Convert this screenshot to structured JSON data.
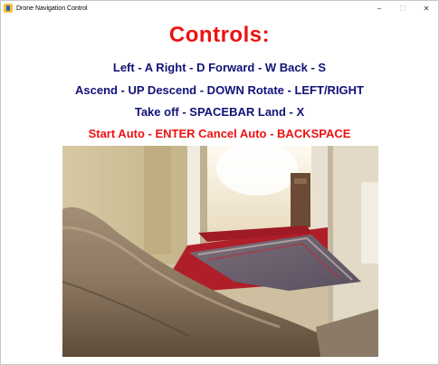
{
  "window": {
    "title": "Drone Navigation Control",
    "controls": {
      "minimize": "–",
      "maximize": "☐",
      "close": "✕"
    }
  },
  "content": {
    "heading": "Controls:",
    "line1": "Left - A  Right - D  Forward - W  Back - S",
    "line2": "Ascend - UP  Descend - DOWN  Rotate - LEFT/RIGHT",
    "line3": "Take off - SPACEBAR  Land - X",
    "line4": "Start Auto - ENTER  Cancel Auto - BACKSPACE"
  },
  "colors": {
    "heading": "#ee1111",
    "instructions": "#12127a",
    "auto_line": "#ee1111"
  }
}
